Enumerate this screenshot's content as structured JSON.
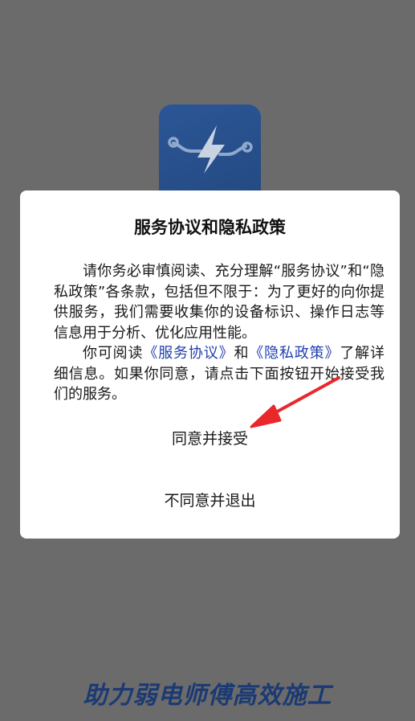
{
  "dialog": {
    "title": "服务协议和隐私政策",
    "para1": "请你务必审慎阅读、充分理解“服务协议”和“隐私政策”各条款，包括但不限于：为了更好的向你提供服务，我们需要收集你的设备标识、操作日志等信息用于分析、优化应用性能。",
    "para2_prefix": "你可阅读",
    "service_link": "《服务协议》",
    "para2_and": "和",
    "privacy_link": "《隐私政策》",
    "para2_suffix": "了解详细信息。如果你同意，请点击下面按钮开始接受我们的服务。",
    "agree_label": "同意并接受",
    "disagree_label": "不同意并退出"
  },
  "background": {
    "slogan": "助力弱电师傅高效施工",
    "logo_icon": "lightning-circuit-icon"
  },
  "colors": {
    "overlay": "#6b6b6b",
    "brand_blue": "#2b5696",
    "link": "#1f3fae",
    "annotation_red": "#e8282b"
  }
}
